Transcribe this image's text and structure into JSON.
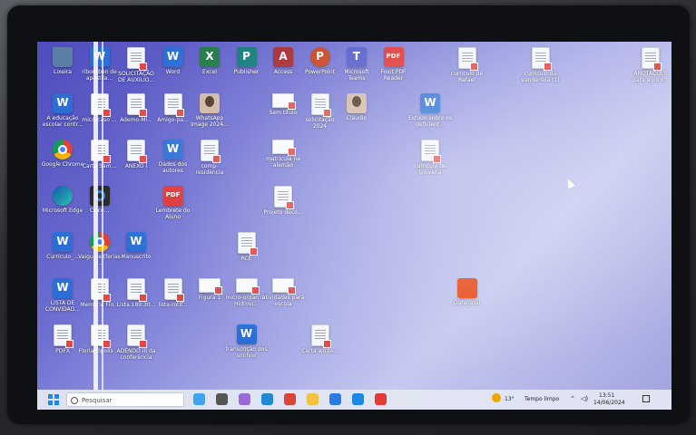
{
  "desktop_icons": [
    {
      "label": "Lixeira",
      "kind": "trash",
      "col": 0,
      "row": 0
    },
    {
      "label": "ribourbon de apostila...",
      "kind": "word",
      "col": 1,
      "row": 0
    },
    {
      "label": "SOLICITAÇÃO DE AUXILIO...",
      "kind": "doc",
      "col": 2,
      "row": 0
    },
    {
      "label": "Word",
      "kind": "word",
      "col": 3,
      "row": 0
    },
    {
      "label": "Excel",
      "kind": "excel",
      "col": 4,
      "row": 0
    },
    {
      "label": "Publisher",
      "kind": "pub",
      "col": 5,
      "row": 0
    },
    {
      "label": "Access",
      "kind": "access",
      "col": 6,
      "row": 0
    },
    {
      "label": "PowerPoint",
      "kind": "ppt",
      "col": 7,
      "row": 0
    },
    {
      "label": "Microsoft Teams",
      "kind": "teams",
      "col": 8,
      "row": 0
    },
    {
      "label": "Foxit PDF Reader",
      "kind": "pdf",
      "col": 9,
      "row": 0
    },
    {
      "label": "curriculo de Rafael",
      "kind": "doc",
      "col": 11,
      "row": 0
    },
    {
      "label": "curriculo da vanderleia (1)",
      "kind": "doc",
      "col": 13,
      "row": 0
    },
    {
      "label": "ANOTAÇÕES para agrico...",
      "kind": "doc",
      "col": 16,
      "row": 0
    },
    {
      "label": "A educação escolar contr...",
      "kind": "word",
      "col": 0,
      "row": 1
    },
    {
      "label": "microcaso ...",
      "kind": "doc",
      "col": 1,
      "row": 1
    },
    {
      "label": "Ademo-Mi...",
      "kind": "doc",
      "col": 2,
      "row": 1
    },
    {
      "label": "Amigo-pa...",
      "kind": "doc",
      "col": 3,
      "row": 1
    },
    {
      "label": "WhatsApp Image 2024...",
      "kind": "photo",
      "col": 4,
      "row": 1
    },
    {
      "label": "Sem título",
      "kind": "blank",
      "col": 6,
      "row": 1
    },
    {
      "label": "solicitação 2024",
      "kind": "doc",
      "col": 7,
      "row": 1
    },
    {
      "label": "Cláudio",
      "kind": "photo",
      "col": 8,
      "row": 1
    },
    {
      "label": "Estudo sobre os deficient...",
      "kind": "word",
      "col": 10,
      "row": 1
    },
    {
      "label": "Google Chrome",
      "kind": "chrome",
      "col": 0,
      "row": 2
    },
    {
      "label": "Carta Sam...",
      "kind": "doc",
      "col": 1,
      "row": 2
    },
    {
      "label": "ANEXO I",
      "kind": "doc",
      "col": 2,
      "row": 2
    },
    {
      "label": "Dados dos autores",
      "kind": "word",
      "col": 3,
      "row": 2
    },
    {
      "label": "comp-residência",
      "kind": "doc",
      "col": 4,
      "row": 2
    },
    {
      "label": "matrícula na alemão",
      "kind": "blank",
      "col": 6,
      "row": 2
    },
    {
      "label": "curriculo de Giovana",
      "kind": "doc",
      "col": 10,
      "row": 2
    },
    {
      "label": "Microsoft Edge",
      "kind": "edge",
      "col": 0,
      "row": 3
    },
    {
      "label": "Cisco...",
      "kind": "gear",
      "col": 1,
      "row": 3
    },
    {
      "label": "Lembrete do Aluno",
      "kind": "pdf",
      "col": 3,
      "row": 3
    },
    {
      "label": "Projeto deco...",
      "kind": "doc",
      "col": 6,
      "row": 3
    },
    {
      "label": "Currículo_...",
      "kind": "word",
      "col": 0,
      "row": 4
    },
    {
      "label": "Vaiguine (ferias d...",
      "kind": "chrome",
      "col": 1,
      "row": 4
    },
    {
      "label": "Manuscrito",
      "kind": "word",
      "col": 2,
      "row": 4
    },
    {
      "label": "RCE",
      "kind": "doc",
      "col": 5,
      "row": 4
    },
    {
      "label": "LISTA DE CONVIDAD...",
      "kind": "word",
      "col": 0,
      "row": 5
    },
    {
      "label": "Memória Flo...",
      "kind": "doc",
      "col": 1,
      "row": 5
    },
    {
      "label": "Lista 189.30...",
      "kind": "doc",
      "col": 2,
      "row": 5
    },
    {
      "label": "lista-rotif...",
      "kind": "doc",
      "col": 3,
      "row": 5
    },
    {
      "label": "Figura 1",
      "kind": "blank",
      "col": 4,
      "row": 5
    },
    {
      "label": "micro-organ do Hidrovi...",
      "kind": "blank",
      "col": 5,
      "row": 5
    },
    {
      "label": "atividades para escola",
      "kind": "blank",
      "col": 6,
      "row": 5
    },
    {
      "label": "Dafagatal",
      "kind": "office",
      "col": 11,
      "row": 5
    },
    {
      "label": "PDFX",
      "kind": "doc",
      "col": 0,
      "row": 6
    },
    {
      "label": "Florianópolis ...",
      "kind": "doc",
      "col": 1,
      "row": 6
    },
    {
      "label": "ADENDO III da conferência",
      "kind": "doc",
      "col": 2,
      "row": 6
    },
    {
      "label": "transcrição dos sonhos",
      "kind": "word",
      "col": 5,
      "row": 6
    },
    {
      "label": "Carta ajuda...",
      "kind": "doc",
      "col": 7,
      "row": 6
    }
  ],
  "taskbar": {
    "search_placeholder": "Pesquisar",
    "weather_temp": "13°",
    "weather_desc": "Tempo limpo",
    "clock_time": "13:51",
    "clock_date": "14/06/2024",
    "apps": [
      {
        "name": "copilot-icon",
        "color": "#3ea4f0"
      },
      {
        "name": "taskview-icon",
        "color": "#555"
      },
      {
        "name": "copilot-app-icon",
        "color": "#9a6bd8"
      },
      {
        "name": "edge-icon",
        "color": "#1f8ad1"
      },
      {
        "name": "chrome-icon",
        "color": "#db4437"
      },
      {
        "name": "explorer-icon",
        "color": "#f6c142"
      },
      {
        "name": "store-icon",
        "color": "#2c7be5"
      },
      {
        "name": "mail-icon",
        "color": "#1e88e5"
      },
      {
        "name": "youtube-icon",
        "color": "#e53935"
      }
    ]
  }
}
